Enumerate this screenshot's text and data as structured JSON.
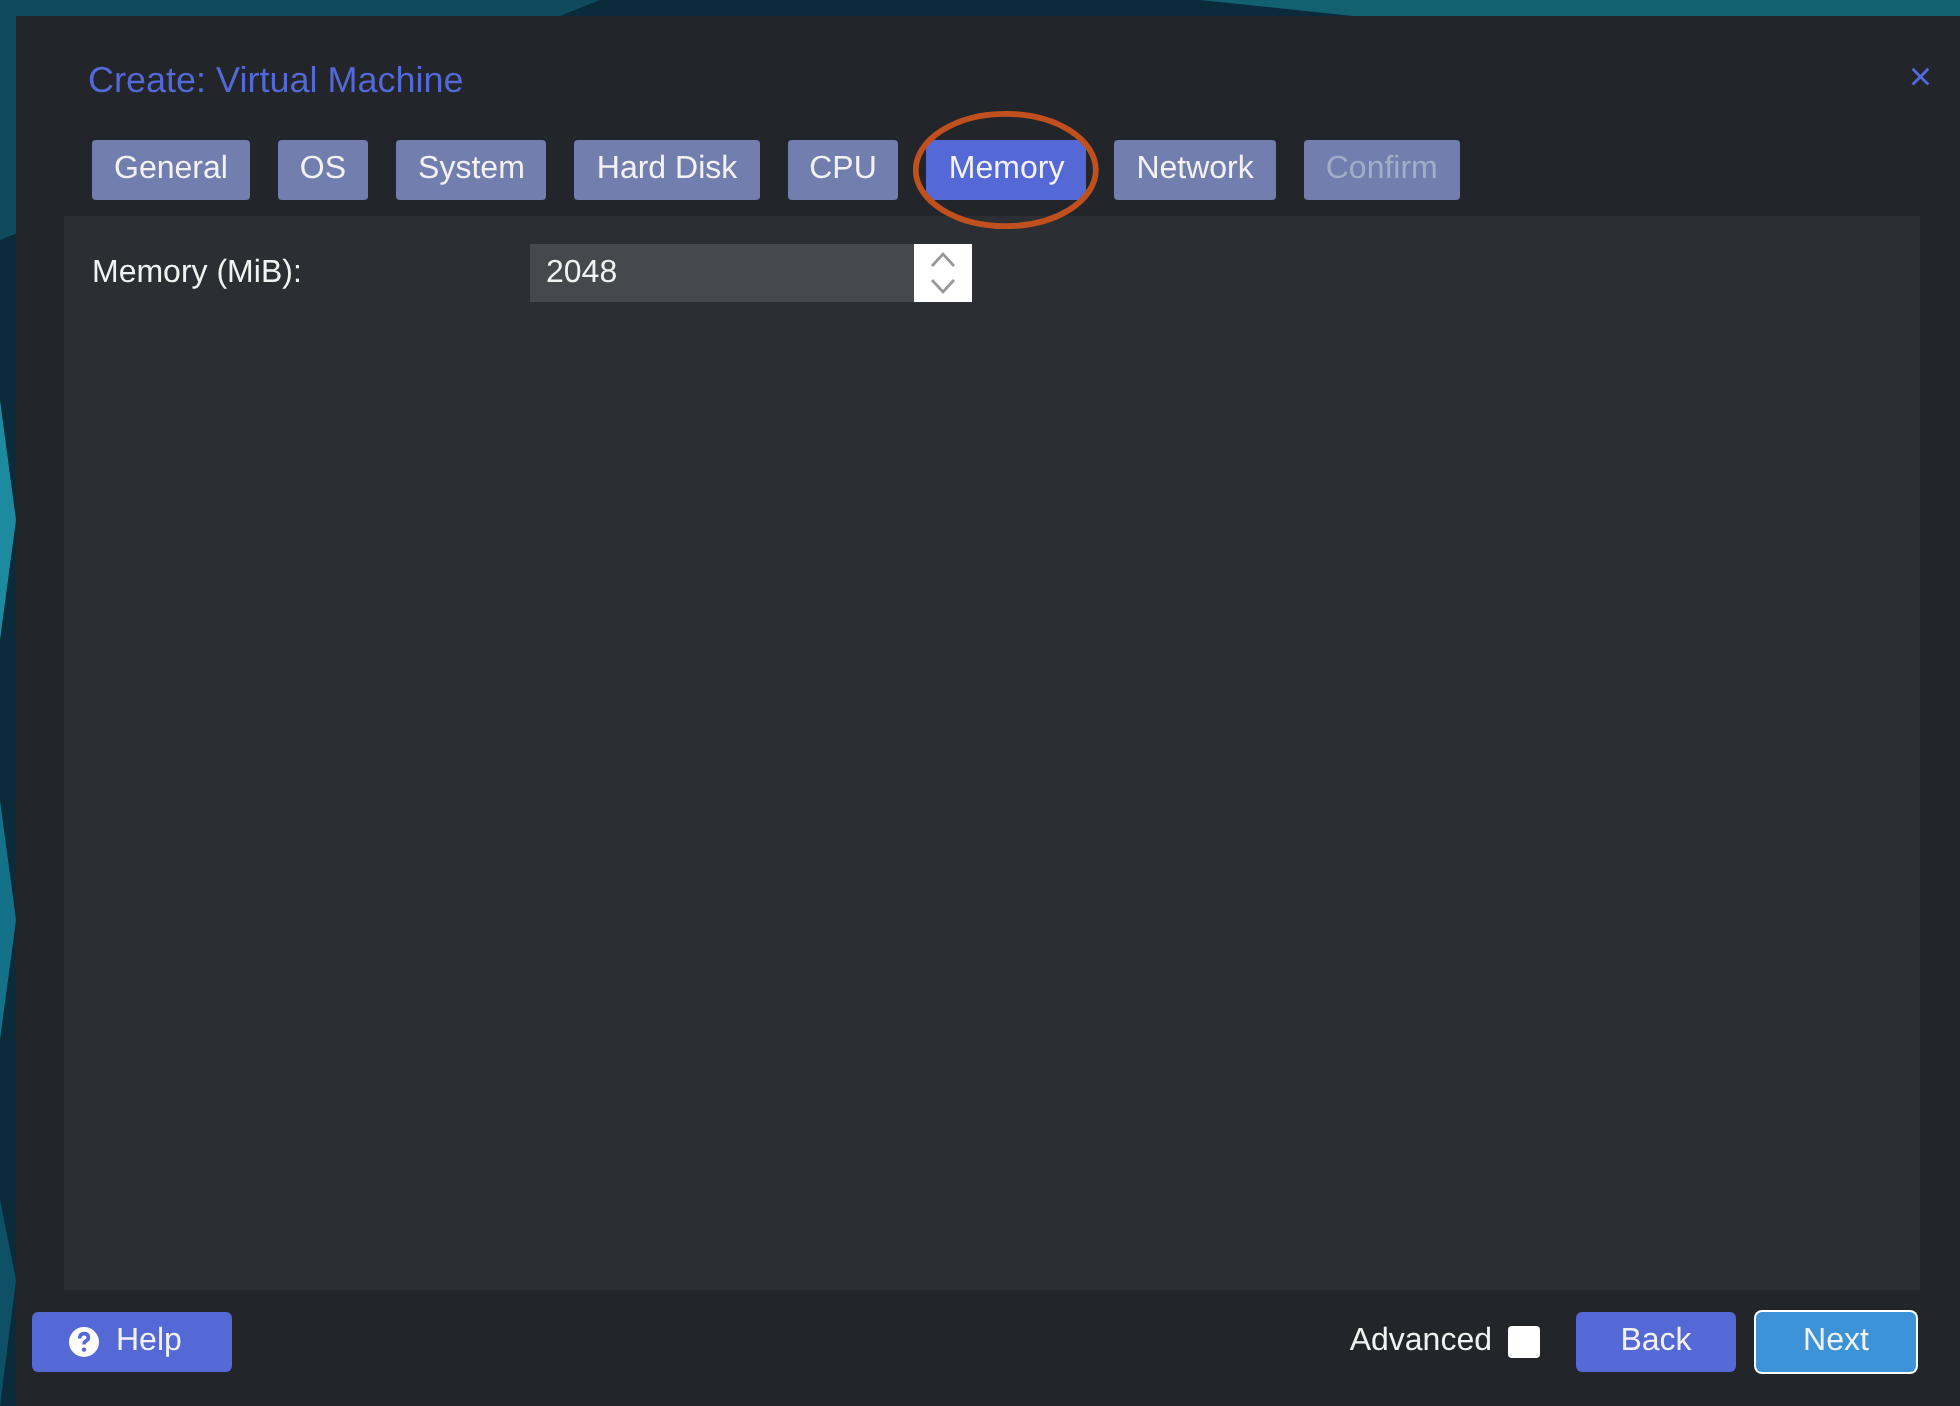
{
  "window": {
    "title": "Create: Virtual Machine",
    "close": "×"
  },
  "tabs": [
    {
      "label": "General",
      "selected": false,
      "disabled": false,
      "circled": false
    },
    {
      "label": "OS",
      "selected": false,
      "disabled": false,
      "circled": false
    },
    {
      "label": "System",
      "selected": false,
      "disabled": false,
      "circled": false
    },
    {
      "label": "Hard Disk",
      "selected": false,
      "disabled": false,
      "circled": false
    },
    {
      "label": "CPU",
      "selected": false,
      "disabled": false,
      "circled": false
    },
    {
      "label": "Memory",
      "selected": true,
      "disabled": false,
      "circled": true
    },
    {
      "label": "Network",
      "selected": false,
      "disabled": false,
      "circled": false
    },
    {
      "label": "Confirm",
      "selected": false,
      "disabled": true,
      "circled": false
    }
  ],
  "form": {
    "label": "Memory (MiB):",
    "value": "2048"
  },
  "footer": {
    "help": "Help",
    "advanced": {
      "label": "Advanced",
      "checked": false
    },
    "buttons": [
      {
        "label": "Back",
        "kind": "normal"
      },
      {
        "label": "Next",
        "kind": "primary"
      }
    ]
  }
}
